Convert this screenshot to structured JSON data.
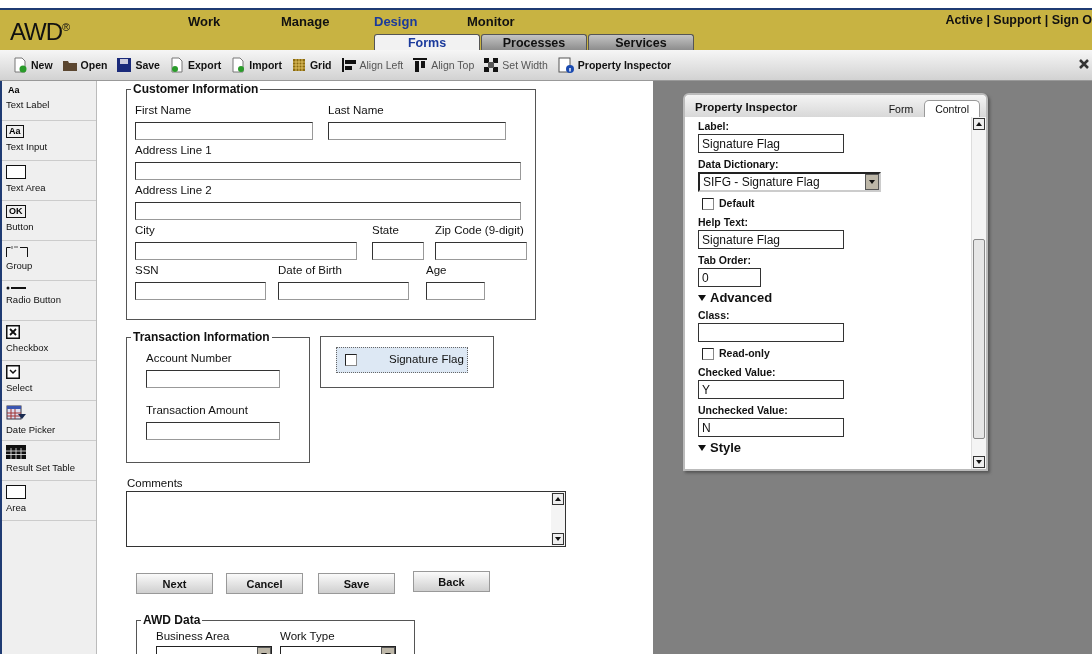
{
  "header": {
    "logo": "AWD",
    "logo_mark": "®",
    "links": "Active | Support | Sign O"
  },
  "nav": [
    {
      "label": "Work",
      "selected": false
    },
    {
      "label": "Manage",
      "selected": false
    },
    {
      "label": "Design",
      "selected": true
    },
    {
      "label": "Monitor",
      "selected": false
    }
  ],
  "subtabs": [
    {
      "label": "Forms",
      "selected": true
    },
    {
      "label": "Processes",
      "selected": false
    },
    {
      "label": "Services",
      "selected": false
    }
  ],
  "toolbar": [
    {
      "kind": "new",
      "label": "New",
      "disabled": false
    },
    {
      "kind": "open",
      "label": "Open",
      "disabled": false
    },
    {
      "kind": "save",
      "label": "Save",
      "disabled": false
    },
    {
      "kind": "export",
      "label": "Export",
      "disabled": false
    },
    {
      "kind": "import",
      "label": "Import",
      "disabled": false
    },
    {
      "kind": "grid",
      "label": "Grid",
      "disabled": false
    },
    {
      "kind": "align-left",
      "label": "Align Left",
      "disabled": true
    },
    {
      "kind": "align-top",
      "label": "Align Top",
      "disabled": true
    },
    {
      "kind": "set-width",
      "label": "Set Width",
      "disabled": true
    },
    {
      "kind": "inspector",
      "label": "Property Inspector",
      "disabled": false
    }
  ],
  "palette": [
    {
      "kind": "label",
      "glyph": "Aa",
      "label": "Text Label"
    },
    {
      "kind": "input",
      "glyph": "Aa",
      "label": "Text Input"
    },
    {
      "kind": "area",
      "label": "Text Area"
    },
    {
      "kind": "button",
      "glyph": "OK",
      "label": "Button"
    },
    {
      "kind": "group",
      "label": "Group"
    },
    {
      "kind": "radio",
      "label": "Radio Button"
    },
    {
      "kind": "checkbox",
      "label": "Checkbox"
    },
    {
      "kind": "select",
      "label": "Select"
    },
    {
      "kind": "date",
      "label": "Date Picker"
    },
    {
      "kind": "table",
      "label": "Result Set Table"
    },
    {
      "kind": "area",
      "label": "Area"
    }
  ],
  "customer_information": {
    "title": "Customer Information",
    "rows": [
      [
        {
          "label": "First Name"
        },
        {
          "label": "Last Name"
        }
      ],
      [
        {
          "label": "Address Line 1"
        }
      ],
      [
        {
          "label": "Address Line 2"
        }
      ],
      [
        {
          "label": "City"
        },
        {
          "label": "State"
        },
        {
          "label": "Zip Code (9-digit)"
        }
      ],
      [
        {
          "label": "SSN"
        },
        {
          "label": "Date of Birth"
        },
        {
          "label": "Age"
        }
      ]
    ]
  },
  "transaction_information": {
    "title": "Transaction Information",
    "fields": [
      {
        "label": "Account Number"
      },
      {
        "label": "Transaction Amount"
      }
    ]
  },
  "signature_control": {
    "label": "Signature Flag",
    "checked": false,
    "selected": true
  },
  "comments": {
    "label": "Comments"
  },
  "buttons": [
    "Next",
    "Cancel",
    "Save",
    "Back"
  ],
  "awd_data": {
    "title": "AWD Data",
    "fields": [
      {
        "label": "Business Area"
      },
      {
        "label": "Work Type"
      }
    ]
  },
  "property_inspector": {
    "title": "Property Inspector",
    "tabs": [
      {
        "label": "Form",
        "selected": false
      },
      {
        "label": "Control",
        "selected": true
      }
    ],
    "items": [
      {
        "kind": "text",
        "label": "Label:",
        "value": "Signature Flag"
      },
      {
        "kind": "select",
        "label": "Data Dictionary:",
        "value": "SIFG - Signature Flag"
      },
      {
        "kind": "checkbox",
        "label": "Default",
        "checked": false
      },
      {
        "kind": "text",
        "label": "Help Text:",
        "value": "Signature Flag"
      },
      {
        "kind": "short",
        "label": "Tab Order:",
        "value": "0"
      },
      {
        "kind": "section",
        "label": "Advanced"
      },
      {
        "kind": "text",
        "label": "Class:"
      },
      {
        "kind": "checkbox",
        "label": "Read-only",
        "checked": false
      },
      {
        "kind": "text",
        "label": "Checked Value:",
        "value": "Y"
      },
      {
        "kind": "text",
        "label": "Unchecked Value:",
        "value": "N"
      },
      {
        "kind": "section",
        "label": "Style"
      }
    ]
  }
}
